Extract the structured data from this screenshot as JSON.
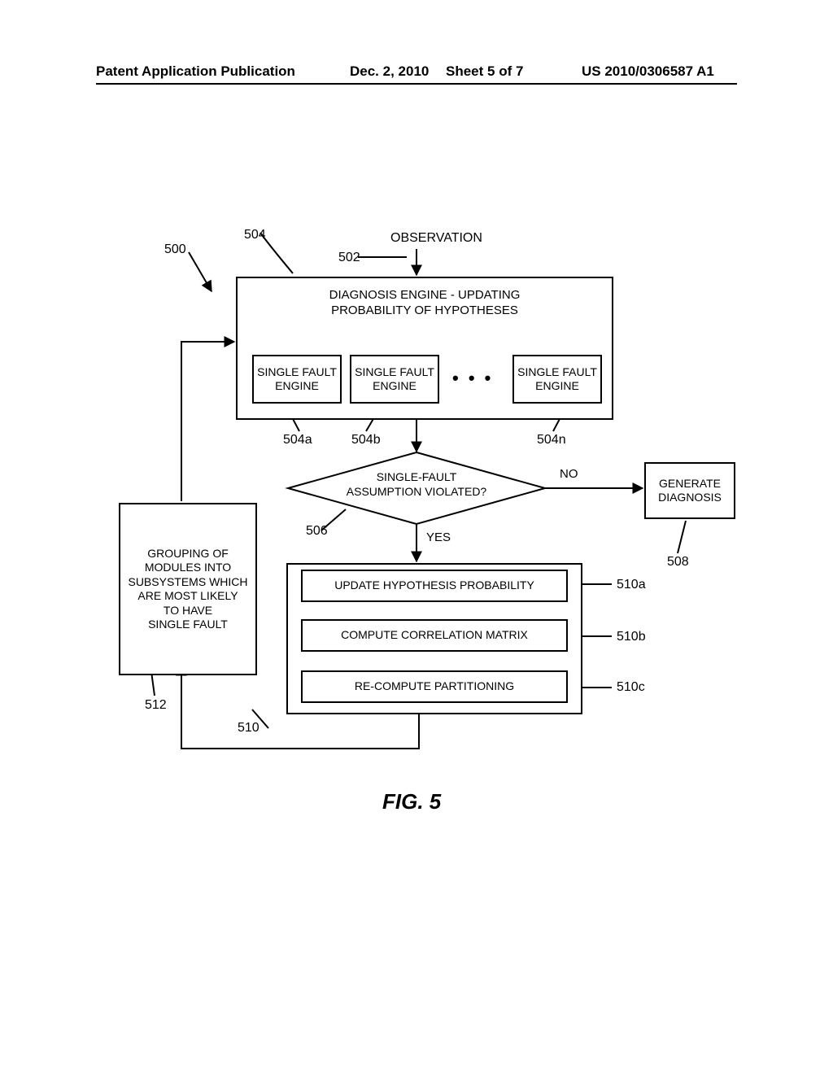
{
  "header": {
    "left": "Patent Application Publication",
    "date": "Dec. 2, 2010",
    "sheet": "Sheet 5 of 7",
    "pubnum": "US 2010/0306587 A1"
  },
  "labels": {
    "observation": "OBSERVATION",
    "n500": "500",
    "n502": "502",
    "n504": "504",
    "n504a": "504a",
    "n504b": "504b",
    "n504n": "504n",
    "n506": "506",
    "n508": "508",
    "n510": "510",
    "n510a": "510a",
    "n510b": "510b",
    "n510c": "510c",
    "n512": "512",
    "no": "NO",
    "yes": "YES",
    "dots": "• • •",
    "fig": "FIG. 5"
  },
  "boxes": {
    "engine_title1": "DIAGNOSIS ENGINE - UPDATING",
    "engine_title2": "PROBABILITY OF HYPOTHESES",
    "sfe": "SINGLE FAULT\nENGINE",
    "decision1": "SINGLE-FAULT",
    "decision2": "ASSUMPTION VIOLATED?",
    "gen1": "GENERATE",
    "gen2": "DIAGNOSIS",
    "step_a": "UPDATE HYPOTHESIS PROBABILITY",
    "step_b": "COMPUTE CORRELATION MATRIX",
    "step_c": "RE-COMPUTE PARTITIONING",
    "grouping": "GROUPING OF\nMODULES INTO\nSUBSYSTEMS WHICH\nARE MOST LIKELY\nTO HAVE\nSINGLE FAULT"
  }
}
